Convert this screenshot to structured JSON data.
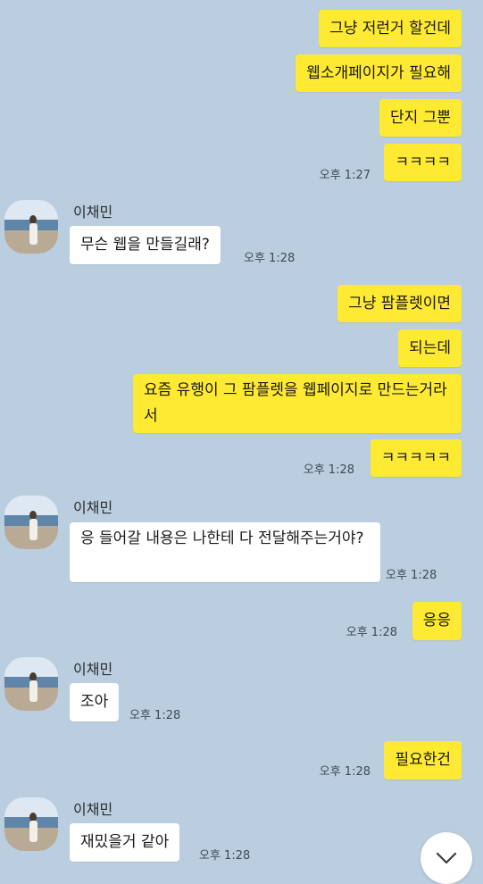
{
  "colors": {
    "background": "#bacee0",
    "my_bubble": "#fee933",
    "their_bubble": "#ffffff"
  },
  "contact": {
    "name": "이채민",
    "avatar_icon": "profile-photo-beach-icon"
  },
  "messages": [
    {
      "from": "me",
      "text": "그냥 저런거 할건데"
    },
    {
      "from": "me",
      "text": "웹소개페이지가 필요해"
    },
    {
      "from": "me",
      "text": "단지 그뿐"
    },
    {
      "from": "me",
      "text": "ㅋㅋㅋㅋ",
      "time": "오후 1:27"
    },
    {
      "from": "them",
      "sender": "이채민",
      "text": "무슨 웹을 만들길래?",
      "time": "오후 1:28"
    },
    {
      "from": "me",
      "text": "그냥 팜플렛이면"
    },
    {
      "from": "me",
      "text": "되는데"
    },
    {
      "from": "me",
      "text": "요즘 유행이 그 팜플렛을 웹페이지로 만드는거라서"
    },
    {
      "from": "me",
      "text": "ㅋㅋㅋㅋㅋ",
      "time": "오후 1:28"
    },
    {
      "from": "them",
      "sender": "이채민",
      "text": "응 들어갈 내용은 나한테 다 전달해주는거야?",
      "time": "오후 1:28"
    },
    {
      "from": "me",
      "text": "응응",
      "time": "오후 1:28"
    },
    {
      "from": "them",
      "sender": "이채민",
      "text": "조아",
      "time": "오후 1:28"
    },
    {
      "from": "me",
      "text": "필요한건",
      "time": "오후 1:28"
    },
    {
      "from": "them",
      "sender": "이채민",
      "text": "재밌을거 같아",
      "time": "오후 1:28"
    }
  ],
  "scroll_button": {
    "icon": "chevron-down-icon"
  }
}
